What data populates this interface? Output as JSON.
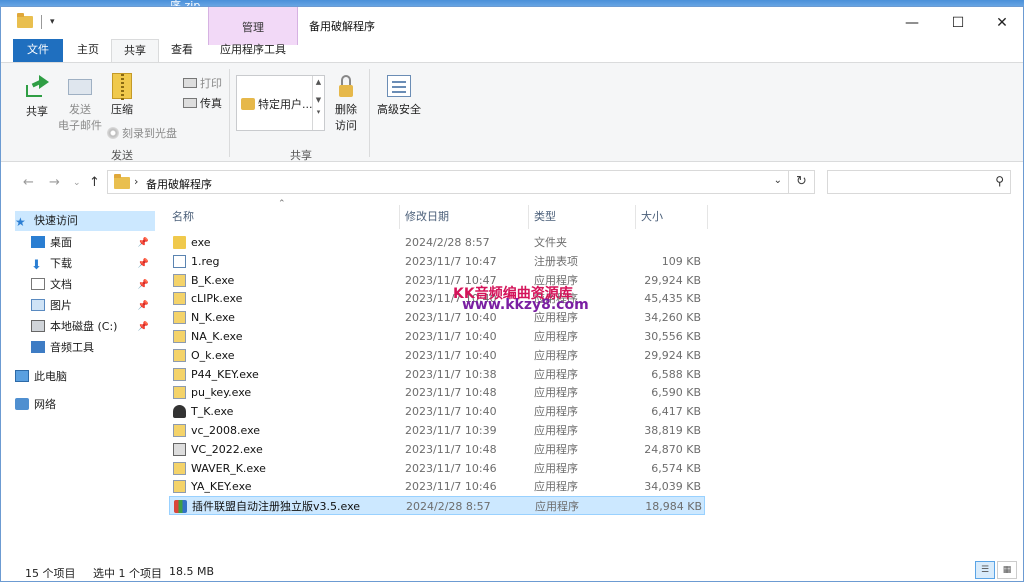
{
  "desktop_caption": "序.zip",
  "window": {
    "title": "备用破解程序",
    "context_tab": "管理",
    "controls": {
      "minimize": "—",
      "maximize": "☐",
      "close": "✕"
    }
  },
  "tabs": {
    "file": "文件",
    "home": "主页",
    "share": "共享",
    "view": "查看",
    "apptools": "应用程序工具"
  },
  "ribbon": {
    "share": "共享",
    "email_line1": "发送",
    "email_line2": "电子邮件",
    "zip": "压缩",
    "burn": "刻录到光盘",
    "print": "打印",
    "fax": "传真",
    "send_group": "发送",
    "specific_users": "特定用户...",
    "remove_access_line1": "删除",
    "remove_access_line2": "访问",
    "advanced_security": "高级安全",
    "share_group": "共享"
  },
  "address": {
    "path": "备用破解程序",
    "search_placeholder": ""
  },
  "nav": {
    "quick_access": "快速访问",
    "desktop": "桌面",
    "downloads": "下载",
    "documents": "文档",
    "pictures": "图片",
    "local_disk": "本地磁盘 (C:)",
    "audio_tools": "音频工具",
    "this_pc": "此电脑",
    "network": "网络"
  },
  "columns": {
    "name": "名称",
    "date": "修改日期",
    "type": "类型",
    "size": "大小"
  },
  "files": [
    {
      "name": "exe",
      "date": "2024/2/28 8:57",
      "type": "文件夹",
      "size": "",
      "icon": "folder-icon"
    },
    {
      "name": "1.reg",
      "date": "2023/11/7 10:47",
      "type": "注册表项",
      "size": "109 KB",
      "icon": "registry-file-icon"
    },
    {
      "name": "B_K.exe",
      "date": "2023/11/7 10:47",
      "type": "应用程序",
      "size": "29,924 KB",
      "icon": "exe-icon"
    },
    {
      "name": "cLIPk.exe",
      "date": "2023/11/7 10:40",
      "type": "应用程序",
      "size": "45,435 KB",
      "icon": "exe-icon"
    },
    {
      "name": "N_K.exe",
      "date": "2023/11/7 10:40",
      "type": "应用程序",
      "size": "34,260 KB",
      "icon": "exe-icon"
    },
    {
      "name": "NA_K.exe",
      "date": "2023/11/7 10:40",
      "type": "应用程序",
      "size": "30,556 KB",
      "icon": "exe-icon"
    },
    {
      "name": "O_k.exe",
      "date": "2023/11/7 10:40",
      "type": "应用程序",
      "size": "29,924 KB",
      "icon": "exe-icon"
    },
    {
      "name": "P44_KEY.exe",
      "date": "2023/11/7 10:38",
      "type": "应用程序",
      "size": "6,588 KB",
      "icon": "exe-icon"
    },
    {
      "name": "pu_key.exe",
      "date": "2023/11/7 10:48",
      "type": "应用程序",
      "size": "6,590 KB",
      "icon": "exe-icon"
    },
    {
      "name": "T_K.exe",
      "date": "2023/11/7 10:40",
      "type": "应用程序",
      "size": "6,417 KB",
      "icon": "tk-app-icon"
    },
    {
      "name": "vc_2008.exe",
      "date": "2023/11/7 10:39",
      "type": "应用程序",
      "size": "38,819 KB",
      "icon": "exe-icon"
    },
    {
      "name": "VC_2022.exe",
      "date": "2023/11/7 10:48",
      "type": "应用程序",
      "size": "24,870 KB",
      "icon": "vc-installer-icon"
    },
    {
      "name": "WAVER_K.exe",
      "date": "2023/11/7 10:46",
      "type": "应用程序",
      "size": "6,574 KB",
      "icon": "exe-icon"
    },
    {
      "name": "YA_KEY.exe",
      "date": "2023/11/7 10:46",
      "type": "应用程序",
      "size": "34,039 KB",
      "icon": "exe-icon"
    },
    {
      "name": "插件联盟自动注册独立版v3.5.exe",
      "date": "2024/2/28 8:57",
      "type": "应用程序",
      "size": "18,984 KB",
      "icon": "plugin-alliance-icon"
    }
  ],
  "watermark": {
    "line1": "KK音频编曲资源库",
    "line2": "www.kkzy8.com"
  },
  "status": {
    "count": "15 个项目",
    "selected": "选中 1 个项目",
    "size": "18.5 MB"
  }
}
